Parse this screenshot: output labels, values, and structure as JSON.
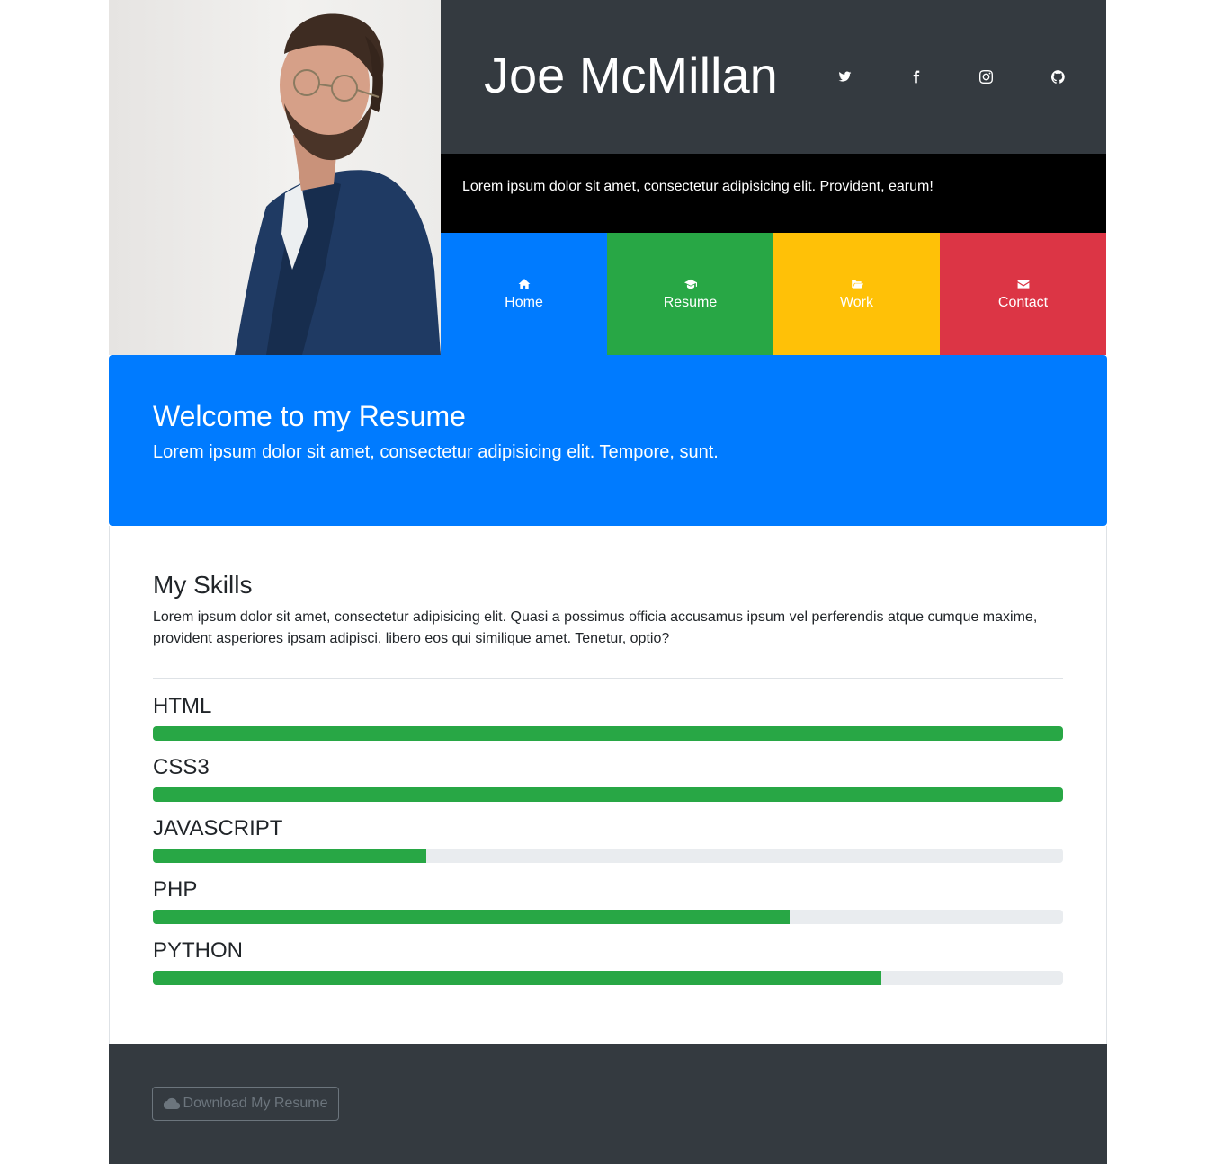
{
  "header": {
    "name": "Joe McMillan",
    "tagline": "Lorem ipsum dolor sit amet, consectetur adipisicing elit. Provident, earum!",
    "social": [
      {
        "icon": "twitter-icon"
      },
      {
        "icon": "facebook-icon"
      },
      {
        "icon": "instagram-icon"
      },
      {
        "icon": "github-icon"
      }
    ]
  },
  "nav": [
    {
      "label": "Home",
      "icon": "home-icon",
      "color": "#007bff"
    },
    {
      "label": "Resume",
      "icon": "graduation-cap-icon",
      "color": "#28a745"
    },
    {
      "label": "Work",
      "icon": "folder-open-icon",
      "color": "#ffc107"
    },
    {
      "label": "Contact",
      "icon": "envelope-icon",
      "color": "#dc3545"
    }
  ],
  "welcome": {
    "title": "Welcome to my Resume",
    "subtitle": "Lorem ipsum dolor sit amet, consectetur adipisicing elit. Tempore, sunt."
  },
  "skills": {
    "title": "My Skills",
    "intro": "Lorem ipsum dolor sit amet, consectetur adipisicing elit. Quasi a possimus officia accusamus ipsum vel perferendis atque cumque maxime, provident asperiores ipsam adipisci, libero eos qui similique amet. Tenetur, optio?",
    "items": [
      {
        "name": "HTML",
        "percent": 100
      },
      {
        "name": "CSS3",
        "percent": 100
      },
      {
        "name": "JAVASCRIPT",
        "percent": 30
      },
      {
        "name": "PHP",
        "percent": 70
      },
      {
        "name": "PYTHON",
        "percent": 80
      }
    ]
  },
  "footer": {
    "download_label": "Download My Resume",
    "download_icon": "cloud-icon"
  },
  "colors": {
    "dark": "#343a40",
    "primary": "#007bff",
    "success": "#28a745",
    "warning": "#ffc107",
    "danger": "#dc3545",
    "track": "#e9ecef"
  }
}
